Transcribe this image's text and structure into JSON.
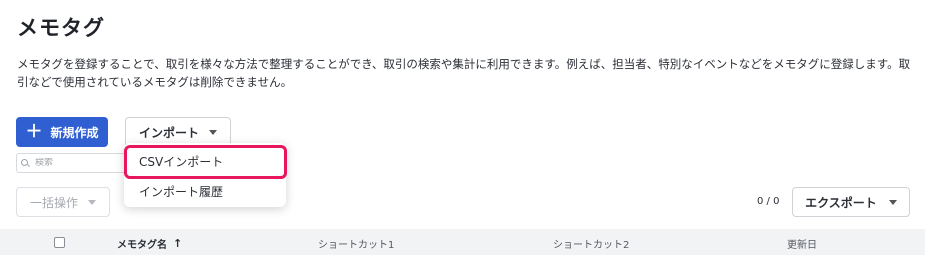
{
  "page": {
    "title": "メモタグ",
    "description": "メモタグを登録することで、取引を様々な方法で整理することができ、取引の検索や集計に利用できます。例えば、担当者、特別なイベントなどをメモタグに登録します。取引などで使用されているメモタグは削除できません。"
  },
  "toolbar": {
    "new_label": "新規作成",
    "import_label": "インポート",
    "search_placeholder": "検索",
    "bulk_label": "一括操作",
    "count": "0 / 0",
    "export_label": "エクスポート"
  },
  "import_menu": {
    "items": [
      {
        "label": "CSVインポート",
        "highlighted": true
      },
      {
        "label": "インポート履歴"
      }
    ],
    "highlight_color": "#e8175d"
  },
  "table": {
    "columns": [
      "メモタグ名",
      "ショートカット1",
      "ショートカット2",
      "更新日"
    ],
    "sort_indicator": "↑"
  },
  "colors": {
    "primary": "#2f5fd0",
    "highlight": "#e8175d"
  }
}
